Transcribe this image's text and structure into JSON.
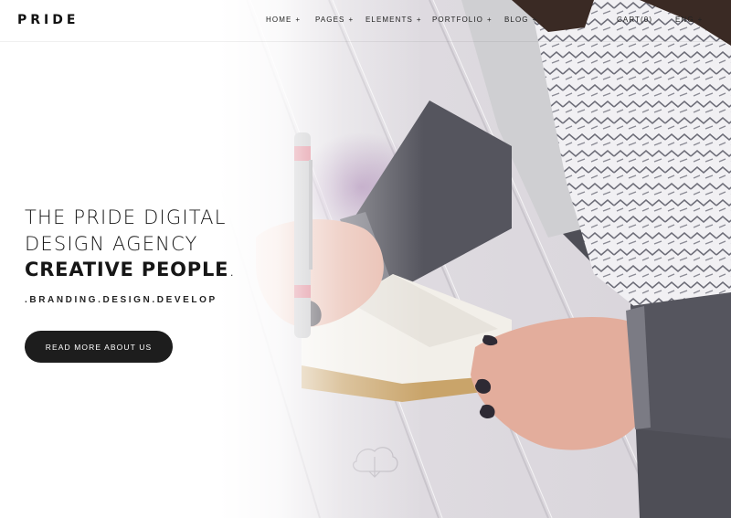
{
  "header": {
    "logo": "PRIDE",
    "nav": [
      {
        "label": "HOME",
        "suffix": "+"
      },
      {
        "label": "PAGES",
        "suffix": "+"
      },
      {
        "label": "ELEMENTS",
        "suffix": "+"
      },
      {
        "label": "PORTFOLIO",
        "suffix": "+"
      },
      {
        "label": "BLOG",
        "suffix": "+"
      },
      {
        "label": "CART(0)",
        "suffix": ""
      },
      {
        "label": "ENG",
        "suffix": "+"
      }
    ]
  },
  "hero": {
    "line1": "THE PRIDE DIGITAL",
    "line2": "DESIGN AGENCY",
    "line3_bold": "CREATIVE PEOPLE",
    "line3_period": ".",
    "tagline": ".BRANDING.DESIGN.DEVELOP",
    "cta_label": "READ MORE ABOUT US"
  },
  "colors": {
    "accent": "#1d1d1d",
    "text": "#161616",
    "background": "#ffffff"
  }
}
